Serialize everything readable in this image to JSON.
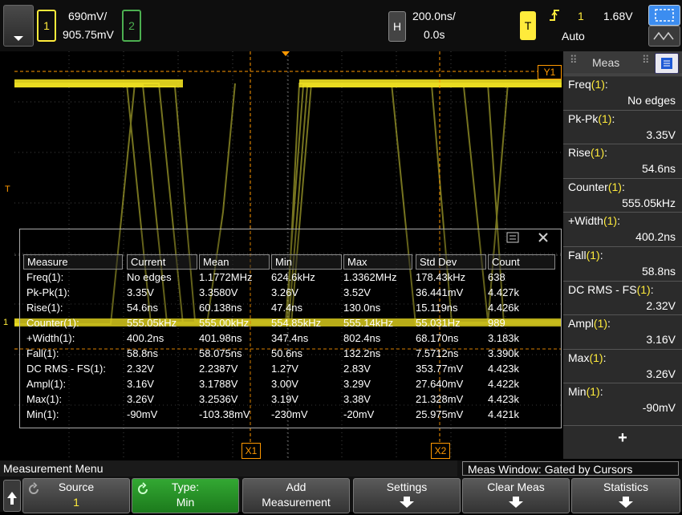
{
  "top": {
    "channel1_label": "1",
    "channel1_scale": "690mV/",
    "channel1_offset": "905.75mV",
    "channel2_label": "2",
    "horizontal_label": "H",
    "timebase": "200.0ns/",
    "delay": "0.0s",
    "trigger_label": "T",
    "trigger_source": "1",
    "trigger_level": "1.68V",
    "trigger_mode": "Auto"
  },
  "screen": {
    "marker_y1": "Y1",
    "marker_x1": "X1",
    "marker_x2": "X2",
    "trigger_marker": "T",
    "ground_marker": "1"
  },
  "sidebar": {
    "title": "Meas",
    "add_label": "+",
    "items": [
      {
        "label": "Freq",
        "ch": "(1)",
        "suffix": ":",
        "value": "No edges"
      },
      {
        "label": "Pk-Pk",
        "ch": "(1)",
        "suffix": ":",
        "value": "3.35V"
      },
      {
        "label": "Rise",
        "ch": "(1)",
        "suffix": ":",
        "value": "54.6ns"
      },
      {
        "label": "Counter",
        "ch": "(1)",
        "suffix": ":",
        "value": "555.05kHz"
      },
      {
        "label": "+Width",
        "ch": "(1)",
        "suffix": ":",
        "value": "400.2ns"
      },
      {
        "label": "Fall",
        "ch": "(1)",
        "suffix": ":",
        "value": "58.8ns"
      },
      {
        "label": "DC RMS - FS",
        "ch": "(1)",
        "suffix": ":",
        "value": "2.32V"
      },
      {
        "label": "Ampl",
        "ch": "(1)",
        "suffix": ":",
        "value": "3.16V"
      },
      {
        "label": "Max",
        "ch": "(1)",
        "suffix": ":",
        "value": "3.26V"
      },
      {
        "label": "Min",
        "ch": "(1)",
        "suffix": ":",
        "value": "-90mV"
      }
    ]
  },
  "table": {
    "headers": [
      "Measure",
      "Current",
      "Mean",
      "Min",
      "Max",
      "Std Dev",
      "Count"
    ],
    "rows": [
      [
        "Freq(1):",
        "No edges",
        "1.1772MHz",
        "624.6kHz",
        "1.3362MHz",
        "178.43kHz",
        "638"
      ],
      [
        "Pk-Pk(1):",
        "3.35V",
        "3.3580V",
        "3.26V",
        "3.52V",
        "36.441mV",
        "4.427k"
      ],
      [
        "Rise(1):",
        "54.6ns",
        "60.138ns",
        "47.4ns",
        "130.0ns",
        "15.119ns",
        "4.426k"
      ],
      [
        "Counter(1):",
        "555.05kHz",
        "555.00kHz",
        "554.85kHz",
        "555.14kHz",
        "55.031Hz",
        "989"
      ],
      [
        "+Width(1):",
        "400.2ns",
        "401.98ns",
        "347.4ns",
        "802.4ns",
        "68.170ns",
        "3.183k"
      ],
      [
        "Fall(1):",
        "58.8ns",
        "58.075ns",
        "50.6ns",
        "132.2ns",
        "7.5712ns",
        "3.390k"
      ],
      [
        "DC RMS - FS(1):",
        "2.32V",
        "2.2387V",
        "1.27V",
        "2.83V",
        "353.77mV",
        "4.423k"
      ],
      [
        "Ampl(1):",
        "3.16V",
        "3.1788V",
        "3.00V",
        "3.29V",
        "27.640mV",
        "4.422k"
      ],
      [
        "Max(1):",
        "3.26V",
        "3.2536V",
        "3.19V",
        "3.38V",
        "21.328mV",
        "4.423k"
      ],
      [
        "Min(1):",
        "-90mV",
        "-103.38mV",
        "-230mV",
        "-20mV",
        "25.975mV",
        "4.421k"
      ]
    ]
  },
  "bottom": {
    "menu_title": "Measurement Menu",
    "window_status": "Meas Window: Gated by Cursors",
    "keys": [
      {
        "l1": "Source",
        "l2": "1"
      },
      {
        "l1": "Type:",
        "l2": "Min"
      },
      {
        "l1": "Add",
        "l2": "Measurement"
      },
      {
        "l1": "Settings",
        "l2": ""
      },
      {
        "l1": "Clear Meas",
        "l2": ""
      },
      {
        "l1": "Statistics",
        "l2": ""
      }
    ]
  },
  "colors": {
    "channel1": "#ffeb3b",
    "channel2": "#4caf50",
    "cursor": "#ff9800",
    "accent": "#1e5ad6"
  }
}
